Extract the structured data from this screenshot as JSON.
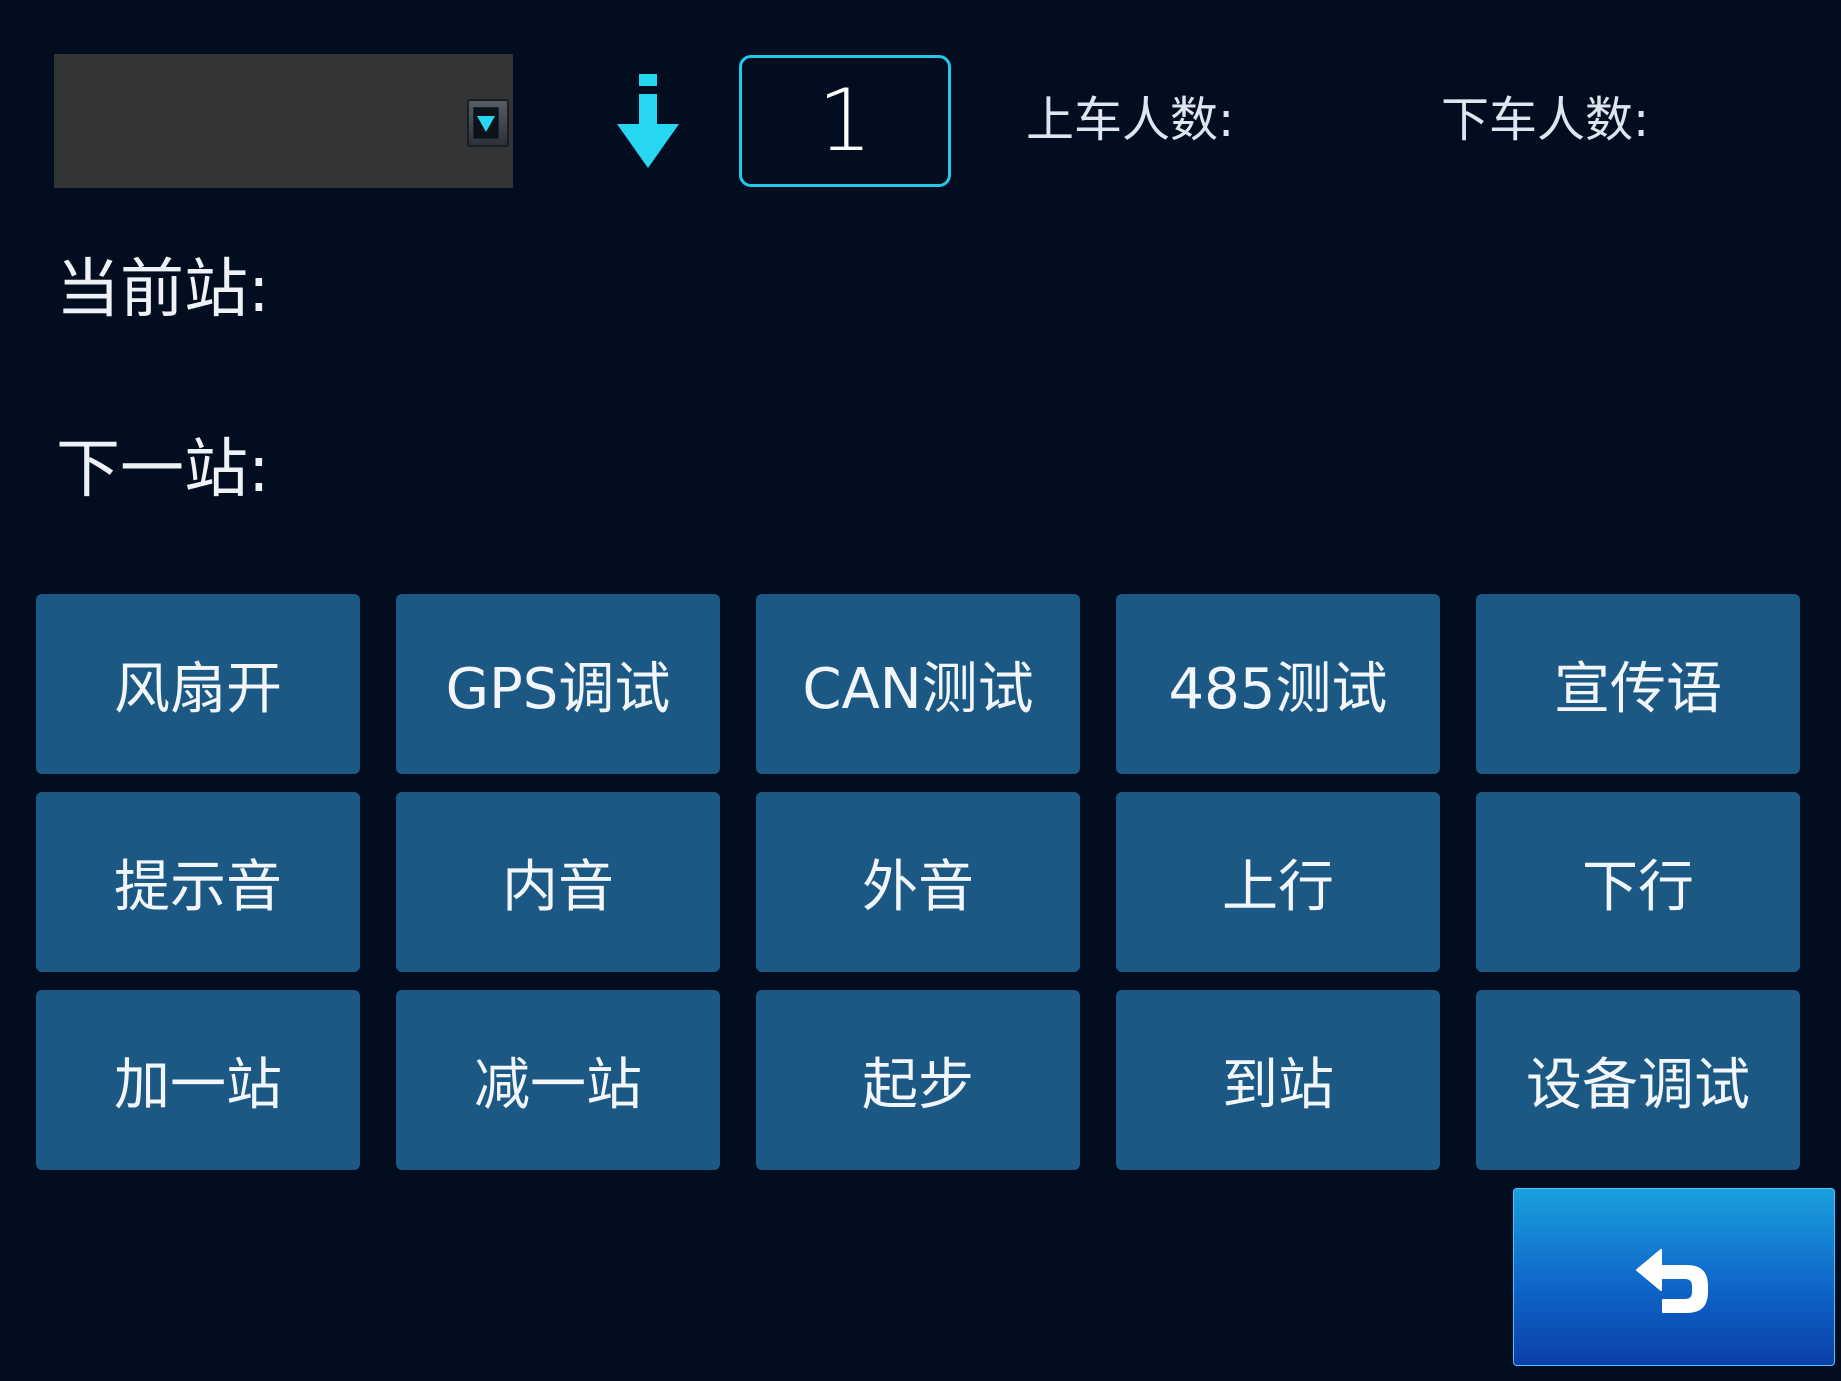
{
  "header": {
    "route_select_value": "",
    "current_stop_number": "1",
    "boarding_label": "上车人数:",
    "alighting_label": "下车人数:"
  },
  "info": {
    "current_station_label": "当前站:",
    "next_station_label": "下一站:"
  },
  "buttons": [
    {
      "label": "风扇开"
    },
    {
      "label": "GPS调试"
    },
    {
      "label": "CAN测试"
    },
    {
      "label": "485测试"
    },
    {
      "label": "宣传语"
    },
    {
      "label": "提示音"
    },
    {
      "label": "内音"
    },
    {
      "label": "外音"
    },
    {
      "label": "上行"
    },
    {
      "label": "下行"
    },
    {
      "label": "加一站"
    },
    {
      "label": "减一站"
    },
    {
      "label": "起步"
    },
    {
      "label": "到站"
    },
    {
      "label": "设备调试"
    }
  ],
  "icons": {
    "direction": "down-arrow-icon",
    "back": "return-arrow-icon",
    "dropdown": "dropdown-arrow-icon"
  },
  "colors": {
    "background": "#020d20",
    "button": "#1b5984",
    "accent": "#22c9e6",
    "back_button": "#0f66c8"
  }
}
